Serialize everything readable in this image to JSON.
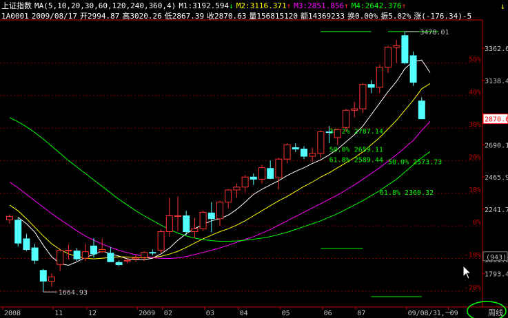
{
  "header": {
    "title": "上证指数",
    "ma_params": "MA(5,10,20,30,60,120,240,360,4)",
    "m1": "M1:3192.594",
    "m1_arrow": "↓",
    "m2": "M2:3116.371",
    "m2_arrow": "↑",
    "m3": "M3:2851.856",
    "m3_arrow": "↑",
    "m4": "M4:2642.376",
    "m4_arrow": "↑",
    "line2": {
      "code": "1A0001",
      "date": "2009/08/17",
      "open": "开2994.87",
      "high": "高3020.26",
      "low": "低2867.39",
      "close": "收2870.63",
      "volume": "量156815120",
      "amount": "额14369233",
      "turnover": "换0.00%",
      "amplitude": "振5.02%",
      "change": "涨(-176.34)-5"
    },
    "scroll_arrow": "↓"
  },
  "colors": {
    "background": "#000000",
    "up": "#ff3232",
    "down": "#54ffff",
    "ma5": "#ffffff",
    "ma10": "#ffff00",
    "ma20": "#ff00ff",
    "ma30": "#00ff00",
    "axis": "#c00000",
    "fib": "#00ff00"
  },
  "chart_data": {
    "type": "candlestick",
    "title": "上证指数",
    "period": "周线",
    "ylim": [
      1560,
      3540
    ],
    "price_ticks": [
      "3362.6",
      "3138.4",
      "2690.1",
      "2465.9",
      "2241.7",
      "1891.00",
      "1793.4"
    ],
    "price_tick_values": [
      3362.6,
      3138.4,
      2690.1,
      2465.9,
      2241.7,
      1891.0,
      1793.4
    ],
    "current_price": "2870.63",
    "current_price_value": 2870.63,
    "index_box": "(943)",
    "index_box_value": 1911,
    "pct_ticks": [
      "50%",
      "40%",
      "30%",
      "20%",
      "10%",
      "0%",
      "-10%",
      "-20%"
    ],
    "pct_tick_values": [
      3260,
      3033,
      2806,
      2579,
      2352,
      2125,
      1898,
      1671
    ],
    "x_labels": [
      "2008",
      "11",
      "12",
      "2009",
      "02",
      "03",
      "04",
      "05",
      "06",
      "07",
      "09/08/31,一",
      "09"
    ],
    "x_label_index": [
      0,
      6,
      10,
      16,
      19,
      24,
      28,
      33,
      38,
      42,
      48,
      53
    ],
    "period_label": "周线",
    "annotations": [
      {
        "text": "3478.01",
        "value": 3478.01,
        "index": 47
      },
      {
        "text": "1664.93",
        "value": 1664.93,
        "index": 4
      }
    ],
    "fib_levels": [
      {
        "text": "50.0%",
        "price_text": "2659.11",
        "value": 2659.11
      },
      {
        "text": "38.2%",
        "price_text": "2787.14",
        "value": 2787.14
      },
      {
        "text": "61.8%",
        "price_text": "2589.44",
        "value": 2589.44
      },
      {
        "text": "50.0%",
        "price_text": "2573.73",
        "value": 2573.73
      },
      {
        "text": "61.8%",
        "price_text": "2360.32",
        "value": 2360.32
      }
    ],
    "candles": [
      {
        "o": 2167,
        "h": 2205,
        "l": 2140,
        "c": 2190
      },
      {
        "o": 2165,
        "h": 2185,
        "l": 1980,
        "c": 2005
      },
      {
        "o": 2035,
        "h": 2070,
        "l": 1950,
        "c": 1960
      },
      {
        "o": 1972,
        "h": 2000,
        "l": 1860,
        "c": 1885
      },
      {
        "o": 1815,
        "h": 1825,
        "l": 1664.93,
        "c": 1740
      },
      {
        "o": 1740,
        "h": 1795,
        "l": 1700,
        "c": 1770
      },
      {
        "o": 1856,
        "h": 1960,
        "l": 1810,
        "c": 1955
      },
      {
        "o": 1955,
        "h": 1995,
        "l": 1890,
        "c": 1955
      },
      {
        "o": 1950,
        "h": 1970,
        "l": 1880,
        "c": 1895
      },
      {
        "o": 1900,
        "h": 2000,
        "l": 1880,
        "c": 1945
      },
      {
        "o": 1985,
        "h": 2040,
        "l": 1905,
        "c": 1930
      },
      {
        "o": 1945,
        "h": 2035,
        "l": 1935,
        "c": 1960
      },
      {
        "o": 1935,
        "h": 1978,
        "l": 1880,
        "c": 1875
      },
      {
        "o": 1870,
        "h": 1885,
        "l": 1845,
        "c": 1855
      },
      {
        "o": 1880,
        "h": 1895,
        "l": 1862,
        "c": 1885
      },
      {
        "o": 1895,
        "h": 1925,
        "l": 1874,
        "c": 1902
      },
      {
        "o": 1905,
        "h": 1947,
        "l": 1880,
        "c": 1940
      },
      {
        "o": 1940,
        "h": 1960,
        "l": 1920,
        "c": 1938
      },
      {
        "o": 1956,
        "h": 2100,
        "l": 1936,
        "c": 2085
      },
      {
        "o": 2085,
        "h": 2320,
        "l": 2050,
        "c": 2195
      },
      {
        "o": 2195,
        "h": 2330,
        "l": 2090,
        "c": 2195
      },
      {
        "o": 2195,
        "h": 2230,
        "l": 2060,
        "c": 2085
      },
      {
        "o": 2085,
        "h": 2180,
        "l": 2040,
        "c": 2105
      },
      {
        "o": 2105,
        "h": 2230,
        "l": 2090,
        "c": 2220
      },
      {
        "o": 2215,
        "h": 2290,
        "l": 2080,
        "c": 2175
      },
      {
        "o": 2175,
        "h": 2300,
        "l": 2125,
        "c": 2290
      },
      {
        "o": 2290,
        "h": 2380,
        "l": 2250,
        "c": 2375
      },
      {
        "o": 2375,
        "h": 2420,
        "l": 2320,
        "c": 2395
      },
      {
        "o": 2395,
        "h": 2480,
        "l": 2360,
        "c": 2465
      },
      {
        "o": 2465,
        "h": 2490,
        "l": 2410,
        "c": 2450
      },
      {
        "o": 2450,
        "h": 2550,
        "l": 2420,
        "c": 2530
      },
      {
        "o": 2525,
        "h": 2580,
        "l": 2450,
        "c": 2455
      },
      {
        "o": 2460,
        "h": 2600,
        "l": 2380,
        "c": 2590
      },
      {
        "o": 2590,
        "h": 2700,
        "l": 2560,
        "c": 2690
      },
      {
        "o": 2670,
        "h": 2700,
        "l": 2640,
        "c": 2660
      },
      {
        "o": 2660,
        "h": 2680,
        "l": 2590,
        "c": 2610
      },
      {
        "o": 2610,
        "h": 2670,
        "l": 2570,
        "c": 2630
      },
      {
        "o": 2630,
        "h": 2790,
        "l": 2600,
        "c": 2780
      },
      {
        "o": 2780,
        "h": 2820,
        "l": 2700,
        "c": 2775
      },
      {
        "o": 2740,
        "h": 2800,
        "l": 2690,
        "c": 2795
      },
      {
        "o": 2810,
        "h": 2940,
        "l": 2780,
        "c": 2930
      },
      {
        "o": 2930,
        "h": 2990,
        "l": 2880,
        "c": 2940
      },
      {
        "o": 2940,
        "h": 3120,
        "l": 2910,
        "c": 3110
      },
      {
        "o": 3110,
        "h": 3140,
        "l": 3050,
        "c": 3090
      },
      {
        "o": 3090,
        "h": 3250,
        "l": 3050,
        "c": 3230
      },
      {
        "o": 3230,
        "h": 3380,
        "l": 3190,
        "c": 3370
      },
      {
        "o": 3370,
        "h": 3420,
        "l": 3260,
        "c": 3380
      },
      {
        "o": 3450,
        "h": 3478.01,
        "l": 3250,
        "c": 3260
      },
      {
        "o": 3310,
        "h": 3340,
        "l": 3100,
        "c": 3125
      },
      {
        "o": 2994.87,
        "h": 3020.26,
        "l": 2867.39,
        "c": 2870.63
      }
    ],
    "ma_series": [
      {
        "name": "MA5",
        "color": "#ffffff",
        "values": [
          null,
          2185,
          2140,
          2080,
          1990,
          1910,
          1862,
          1850,
          1875,
          1905,
          1925,
          1950,
          1930,
          1915,
          1895,
          1890,
          1890,
          1900,
          1930,
          1970,
          2025,
          2070,
          2105,
          2135,
          2160,
          2175,
          2200,
          2240,
          2290,
          2345,
          2380,
          2410,
          2440,
          2475,
          2505,
          2530,
          2560,
          2585,
          2620,
          2660,
          2710,
          2760,
          2820,
          2900,
          2980,
          3060,
          3130,
          3220,
          3270,
          3280,
          3192
        ]
      },
      {
        "name": "MA10",
        "color": "#ffff00",
        "values": [
          2270,
          2230,
          2175,
          2115,
          2055,
          2000,
          1960,
          1930,
          1912,
          1900,
          1895,
          1900,
          1905,
          1910,
          1908,
          1905,
          1903,
          1905,
          1913,
          1928,
          1948,
          1975,
          2005,
          2035,
          2060,
          2085,
          2105,
          2130,
          2160,
          2195,
          2230,
          2265,
          2300,
          2330,
          2365,
          2400,
          2430,
          2465,
          2495,
          2530,
          2565,
          2600,
          2640,
          2690,
          2740,
          2800,
          2860,
          2930,
          3000,
          3080,
          3116
        ]
      },
      {
        "name": "MA20",
        "color": "#ff00ff",
        "values": [
          2430,
          2390,
          2345,
          2300,
          2255,
          2210,
          2170,
          2130,
          2090,
          2055,
          2025,
          1998,
          1975,
          1955,
          1938,
          1925,
          1913,
          1904,
          1899,
          1898,
          1902,
          1912,
          1925,
          1940,
          1955,
          1972,
          1990,
          2010,
          2030,
          2050,
          2075,
          2100,
          2130,
          2160,
          2190,
          2220,
          2250,
          2280,
          2310,
          2340,
          2375,
          2410,
          2450,
          2490,
          2530,
          2575,
          2620,
          2670,
          2720,
          2790,
          2852
        ]
      },
      {
        "name": "MA30",
        "color": "#00ff00",
        "values": [
          2880,
          2850,
          2815,
          2775,
          2730,
          2680,
          2630,
          2580,
          2535,
          2490,
          2445,
          2400,
          2355,
          2310,
          2270,
          2230,
          2195,
          2162,
          2130,
          2100,
          2075,
          2055,
          2040,
          2030,
          2022,
          2018,
          2018,
          2020,
          2025,
          2032,
          2040,
          2050,
          2065,
          2080,
          2100,
          2120,
          2140,
          2160,
          2185,
          2210,
          2240,
          2270,
          2300,
          2335,
          2370,
          2410,
          2450,
          2500,
          2550,
          2600,
          2642
        ]
      }
    ]
  }
}
